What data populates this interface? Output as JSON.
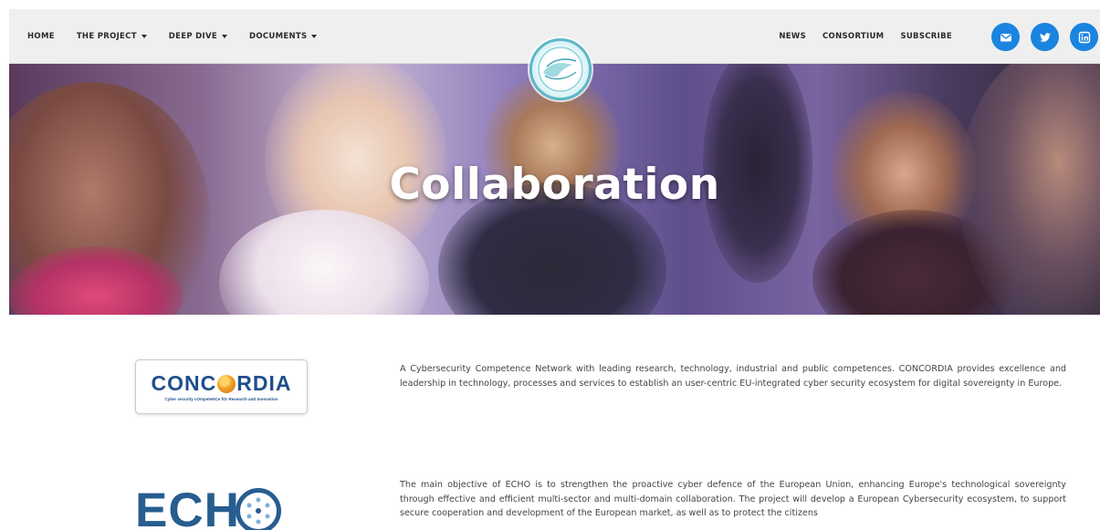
{
  "nav": {
    "left": [
      {
        "label": "HOME",
        "dropdown": false
      },
      {
        "label": "THE PROJECT",
        "dropdown": true
      },
      {
        "label": "DEEP DIVE",
        "dropdown": true
      },
      {
        "label": "DOCUMENTS",
        "dropdown": true
      }
    ],
    "right": [
      {
        "label": "NEWS"
      },
      {
        "label": "CONSORTIUM"
      },
      {
        "label": "SUBSCRIBE"
      }
    ],
    "social": [
      {
        "icon": "envelope-icon"
      },
      {
        "icon": "twitter-icon"
      },
      {
        "icon": "linkedin-icon"
      }
    ]
  },
  "hero": {
    "title": "Collaboration"
  },
  "partners": [
    {
      "logo_text": "CONC",
      "logo_text_end": "RDIA",
      "logo_tagline": "Cyber security cOmpeteNCe fOr Research anD Innovation",
      "description": "A Cybersecurity Competence Network with leading research, technology, industrial and public competences. CONCORDIA provides excellence and leadership in technology, processes and services to establish an user-centric EU-integrated cyber security ecosystem for digital sovereignty in Europe."
    },
    {
      "logo_text": "ECH",
      "description": "The main objective of ECHO is to strengthen the proactive cyber defence of the European Union, enhancing Europe's technological sovereignty through effective and efficient multi-sector and multi-domain collaboration. The project will develop a European Cybersecurity ecosystem, to support secure cooperation and development of the European market, as well as to protect the citizens"
    }
  ],
  "colors": {
    "accent": "#1b84e0",
    "nav_bg": "#efefef",
    "brand_blue": "#275d8f"
  }
}
